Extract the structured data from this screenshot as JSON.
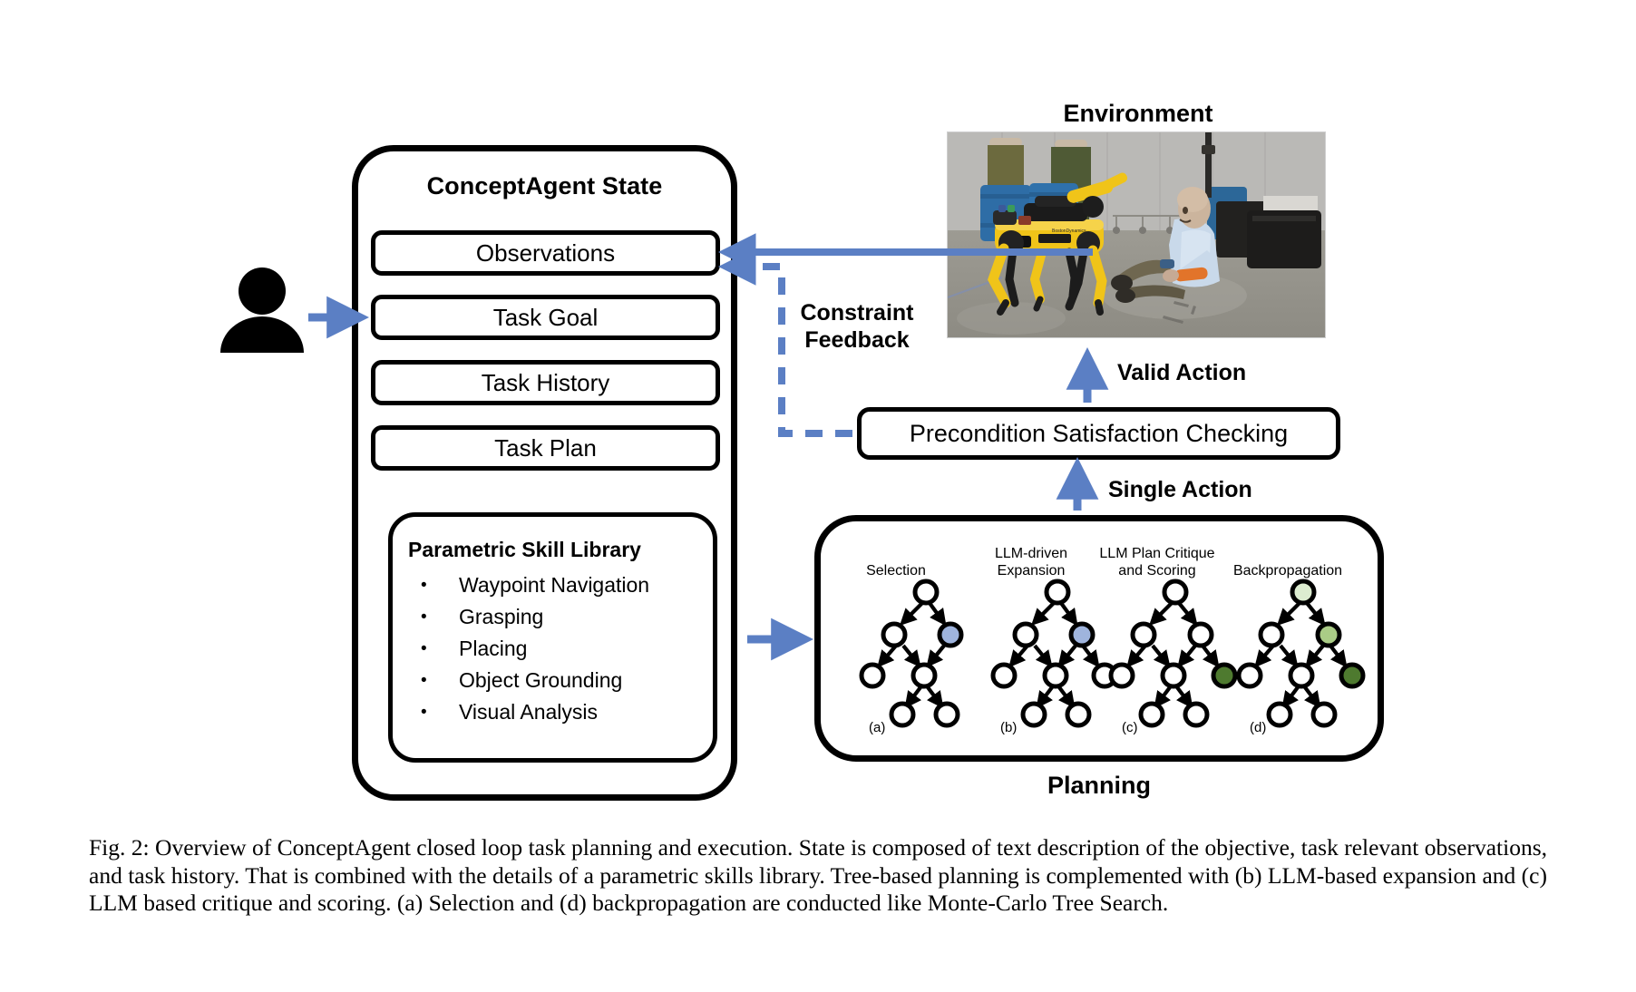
{
  "figure": {
    "id": "fig-2-conceptagent-overview",
    "caption_label": "Fig. 2:",
    "caption_text": "Overview of ConceptAgent closed loop task planning and execution. State is composed of text description of the objective, task relevant observations, and task history. That is combined with the details of a parametric skills library. Tree-based planning is complemented with (b) LLM-based expansion and (c) LLM based critique and scoring. (a) Selection and (d) backpropagation are conducted like Monte-Carlo Tree Search."
  },
  "state_panel": {
    "title": "ConceptAgent State",
    "slots": [
      {
        "label": "Observations"
      },
      {
        "label": "Task Goal"
      },
      {
        "label": "Task History"
      },
      {
        "label": "Task Plan"
      }
    ],
    "skill_library": {
      "title": "Parametric Skill Library",
      "items": [
        "Waypoint Navigation",
        "Grasping",
        "Placing",
        "Object Grounding",
        "Visual Analysis"
      ]
    }
  },
  "environment": {
    "title": "Environment",
    "image_alt": "Boston Dynamics Spot quadruped robot with arm in a warehouse facing a seated mannequin casualty",
    "scene": {
      "robot": "Boston Dynamics Spot",
      "robot_color": "#f2c21b",
      "floor_color": "#9c9a93",
      "wall_color": "#b9b8b6",
      "barrel_color": "#2f6fa8",
      "mannequin_shirt_color": "#c8d8ea",
      "mannequin_pants_color": "#6d6450"
    }
  },
  "precondition": {
    "label": "Precondition Satisfaction Checking"
  },
  "arrows": {
    "color": "#5b7fc4",
    "user_to_state": "user-input-arrow",
    "env_to_observations": "observation-feedback-arrow",
    "constraint_feedback": {
      "label": "Constraint\nFeedback",
      "label_line1": "Constraint",
      "label_line2": "Feedback",
      "style": "dashed"
    },
    "valid_action": {
      "label": "Valid Action"
    },
    "single_action": {
      "label": "Single Action"
    },
    "skills_to_planning": "skills-to-planning-arrow"
  },
  "planning": {
    "title": "Planning",
    "stages": [
      {
        "letter": "(a)",
        "caption": "Selection",
        "caption_lines": [
          "Selection"
        ]
      },
      {
        "letter": "(b)",
        "caption": "LLM-driven Expansion",
        "caption_lines": [
          "LLM-driven",
          "Expansion"
        ]
      },
      {
        "letter": "(c)",
        "caption": "LLM Plan Critique and Scoring",
        "caption_lines": [
          "LLM Plan Critique",
          "and Scoring"
        ]
      },
      {
        "letter": "(d)",
        "caption": "Backpropagation",
        "caption_lines": [
          "Backpropagation"
        ]
      }
    ],
    "node_colors": {
      "empty": "#ffffff",
      "selected_blue": "#9fb4dd",
      "score_green": "#4e7a2f",
      "backprop_light": "#dcecd0",
      "backprop_mid": "#aacc86",
      "outline": "#000000"
    }
  },
  "chart_data": {
    "type": "diagram",
    "title": "ConceptAgent closed loop task planning and execution",
    "nodes": [
      {
        "id": "user",
        "label": "user-icon",
        "type": "actor"
      },
      {
        "id": "state",
        "label": "ConceptAgent State",
        "type": "container"
      },
      {
        "id": "observations",
        "label": "Observations",
        "type": "box"
      },
      {
        "id": "task_goal",
        "label": "Task Goal",
        "type": "box"
      },
      {
        "id": "task_history",
        "label": "Task History",
        "type": "box"
      },
      {
        "id": "task_plan",
        "label": "Task Plan",
        "type": "box"
      },
      {
        "id": "skills",
        "label": "Parametric Skill Library",
        "type": "box"
      },
      {
        "id": "planning",
        "label": "Planning",
        "type": "container"
      },
      {
        "id": "precondition",
        "label": "Precondition Satisfaction Checking",
        "type": "box"
      },
      {
        "id": "environment",
        "label": "Environment",
        "type": "image"
      }
    ],
    "edges": [
      {
        "from": "user",
        "to": "task_goal",
        "label": "",
        "style": "solid"
      },
      {
        "from": "skills",
        "to": "planning",
        "label": "",
        "style": "solid"
      },
      {
        "from": "planning",
        "to": "precondition",
        "label": "Single Action",
        "style": "solid"
      },
      {
        "from": "precondition",
        "to": "environment",
        "label": "Valid Action",
        "style": "solid"
      },
      {
        "from": "precondition",
        "to": "observations",
        "label": "Constraint Feedback",
        "style": "dashed"
      },
      {
        "from": "environment",
        "to": "observations",
        "label": "",
        "style": "solid"
      }
    ],
    "trees": [
      {
        "stage": "(a)",
        "name": "Selection",
        "nodes": [
          {
            "id": "n0",
            "level": 0,
            "fill": "empty"
          },
          {
            "id": "n1",
            "level": 1,
            "fill": "empty"
          },
          {
            "id": "n2",
            "level": 1,
            "fill": "selected_blue"
          },
          {
            "id": "n3",
            "level": 2,
            "fill": "empty"
          },
          {
            "id": "n4",
            "level": 2,
            "fill": "empty"
          },
          {
            "id": "n5",
            "level": 3,
            "fill": "empty"
          },
          {
            "id": "n6",
            "level": 3,
            "fill": "empty"
          }
        ],
        "edges": [
          [
            "n0",
            "n1"
          ],
          [
            "n0",
            "n2"
          ],
          [
            "n1",
            "n3"
          ],
          [
            "n1",
            "n4"
          ],
          [
            "n2",
            "n4"
          ],
          [
            "n4",
            "n5"
          ],
          [
            "n4",
            "n6"
          ]
        ]
      },
      {
        "stage": "(b)",
        "name": "LLM-driven Expansion",
        "nodes": [
          {
            "id": "n0",
            "level": 0,
            "fill": "empty"
          },
          {
            "id": "n1",
            "level": 1,
            "fill": "empty"
          },
          {
            "id": "n2",
            "level": 1,
            "fill": "selected_blue"
          },
          {
            "id": "n3",
            "level": 2,
            "fill": "empty"
          },
          {
            "id": "n4",
            "level": 2,
            "fill": "empty"
          },
          {
            "id": "n5",
            "level": 2,
            "fill": "empty"
          },
          {
            "id": "n6",
            "level": 3,
            "fill": "empty"
          },
          {
            "id": "n7",
            "level": 3,
            "fill": "empty"
          }
        ],
        "edges": [
          [
            "n0",
            "n1"
          ],
          [
            "n0",
            "n2"
          ],
          [
            "n1",
            "n3"
          ],
          [
            "n1",
            "n4"
          ],
          [
            "n2",
            "n4"
          ],
          [
            "n2",
            "n5"
          ],
          [
            "n4",
            "n6"
          ],
          [
            "n4",
            "n7"
          ]
        ]
      },
      {
        "stage": "(c)",
        "name": "LLM Plan Critique and Scoring",
        "nodes": [
          {
            "id": "n0",
            "level": 0,
            "fill": "empty"
          },
          {
            "id": "n1",
            "level": 1,
            "fill": "empty"
          },
          {
            "id": "n2",
            "level": 1,
            "fill": "empty"
          },
          {
            "id": "n3",
            "level": 2,
            "fill": "empty"
          },
          {
            "id": "n4",
            "level": 2,
            "fill": "empty"
          },
          {
            "id": "n5",
            "level": 2,
            "fill": "score_green"
          },
          {
            "id": "n6",
            "level": 3,
            "fill": "empty"
          },
          {
            "id": "n7",
            "level": 3,
            "fill": "empty"
          }
        ],
        "edges": [
          [
            "n0",
            "n1"
          ],
          [
            "n0",
            "n2"
          ],
          [
            "n1",
            "n3"
          ],
          [
            "n1",
            "n4"
          ],
          [
            "n2",
            "n4"
          ],
          [
            "n2",
            "n5"
          ],
          [
            "n4",
            "n6"
          ],
          [
            "n4",
            "n7"
          ]
        ]
      },
      {
        "stage": "(d)",
        "name": "Backpropagation",
        "nodes": [
          {
            "id": "n0",
            "level": 0,
            "fill": "backprop_light"
          },
          {
            "id": "n1",
            "level": 1,
            "fill": "empty"
          },
          {
            "id": "n2",
            "level": 1,
            "fill": "backprop_mid"
          },
          {
            "id": "n3",
            "level": 2,
            "fill": "empty"
          },
          {
            "id": "n4",
            "level": 2,
            "fill": "empty"
          },
          {
            "id": "n5",
            "level": 2,
            "fill": "score_green"
          },
          {
            "id": "n6",
            "level": 3,
            "fill": "empty"
          },
          {
            "id": "n7",
            "level": 3,
            "fill": "empty"
          }
        ],
        "edges": [
          [
            "n0",
            "n1"
          ],
          [
            "n0",
            "n2"
          ],
          [
            "n1",
            "n3"
          ],
          [
            "n1",
            "n4"
          ],
          [
            "n2",
            "n4"
          ],
          [
            "n2",
            "n5"
          ],
          [
            "n4",
            "n6"
          ],
          [
            "n4",
            "n7"
          ]
        ]
      }
    ]
  }
}
